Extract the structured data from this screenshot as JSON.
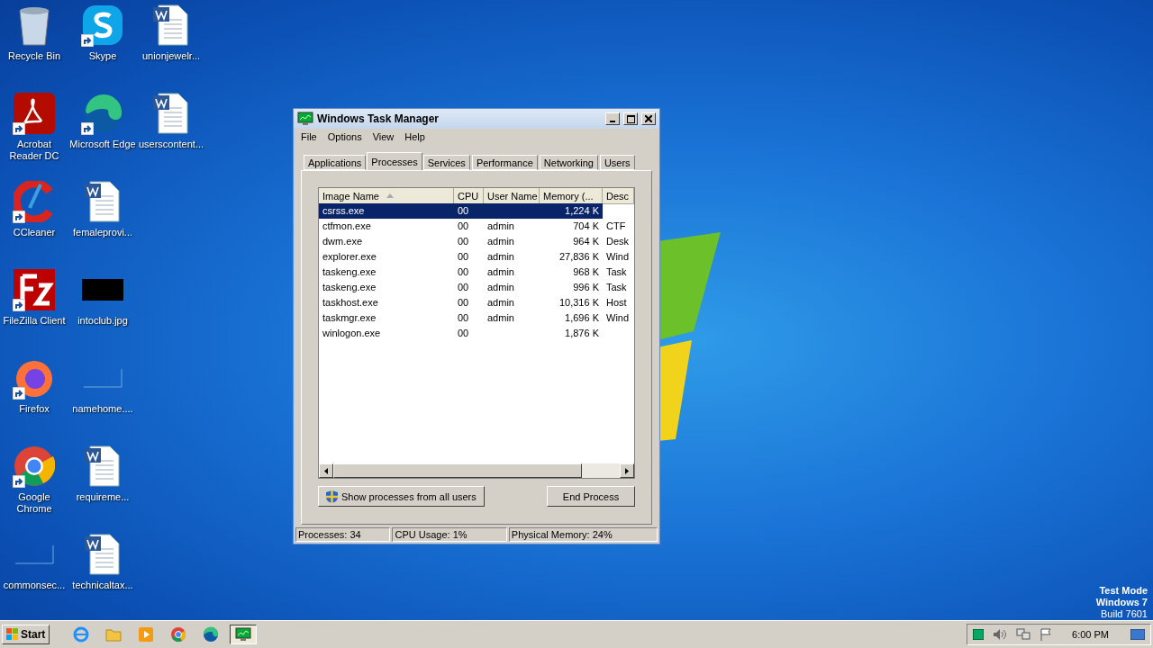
{
  "desktop_icons": [
    {
      "label": "Recycle Bin",
      "kind": "recycle",
      "shortcut": false
    },
    {
      "label": "Acrobat Reader DC",
      "kind": "acrobat",
      "shortcut": true
    },
    {
      "label": "CCleaner",
      "kind": "ccleaner",
      "shortcut": true
    },
    {
      "label": "FileZilla Client",
      "kind": "filezilla",
      "shortcut": true
    },
    {
      "label": "Firefox",
      "kind": "firefox",
      "shortcut": true
    },
    {
      "label": "Google Chrome",
      "kind": "chrome",
      "shortcut": true
    },
    {
      "label": "commonsec...",
      "kind": "blank",
      "shortcut": false
    },
    {
      "label": "Skype",
      "kind": "skype",
      "shortcut": true
    },
    {
      "label": "Microsoft Edge",
      "kind": "edge",
      "shortcut": true
    },
    {
      "label": "femaleprovi...",
      "kind": "word",
      "shortcut": false
    },
    {
      "label": "intoclub.jpg",
      "kind": "image",
      "shortcut": false
    },
    {
      "label": "namehome....",
      "kind": "blank",
      "shortcut": false
    },
    {
      "label": "requireme...",
      "kind": "word",
      "shortcut": false
    },
    {
      "label": "technicaltax...",
      "kind": "word",
      "shortcut": false
    },
    {
      "label": "unionjewelr...",
      "kind": "word",
      "shortcut": false
    },
    {
      "label": "userscontent...",
      "kind": "word",
      "shortcut": false
    }
  ],
  "window": {
    "title": "Windows Task Manager",
    "menu": [
      "File",
      "Options",
      "View",
      "Help"
    ],
    "tabs": [
      {
        "label": "Applications",
        "selected": false
      },
      {
        "label": "Processes",
        "selected": true
      },
      {
        "label": "Services",
        "selected": false
      },
      {
        "label": "Performance",
        "selected": false
      },
      {
        "label": "Networking",
        "selected": false
      },
      {
        "label": "Users",
        "selected": false
      }
    ],
    "table": {
      "columns": [
        "Image Name",
        "CPU",
        "User Name",
        "Memory (...",
        "Desc"
      ],
      "rows": [
        {
          "cells": [
            "csrss.exe",
            "00",
            "",
            "1,224 K",
            ""
          ],
          "selected": true
        },
        {
          "cells": [
            "ctfmon.exe",
            "00",
            "admin",
            "704 K",
            "CTF"
          ],
          "selected": false
        },
        {
          "cells": [
            "dwm.exe",
            "00",
            "admin",
            "964 K",
            "Desk"
          ],
          "selected": false
        },
        {
          "cells": [
            "explorer.exe",
            "00",
            "admin",
            "27,836 K",
            "Wind"
          ],
          "selected": false
        },
        {
          "cells": [
            "taskeng.exe",
            "00",
            "admin",
            "968 K",
            "Task"
          ],
          "selected": false
        },
        {
          "cells": [
            "taskeng.exe",
            "00",
            "admin",
            "996 K",
            "Task"
          ],
          "selected": false
        },
        {
          "cells": [
            "taskhost.exe",
            "00",
            "admin",
            "10,316 K",
            "Host"
          ],
          "selected": false
        },
        {
          "cells": [
            "taskmgr.exe",
            "00",
            "admin",
            "1,696 K",
            "Wind"
          ],
          "selected": false
        },
        {
          "cells": [
            "winlogon.exe",
            "00",
            "",
            "1,876 K",
            ""
          ],
          "selected": false
        }
      ]
    },
    "show_all_button": "Show processes from all users",
    "end_button": "End Process",
    "status_bar": [
      "Processes: 34",
      "CPU Usage: 1%",
      "Physical Memory: 24%"
    ]
  },
  "os_notice": [
    "Test Mode",
    "Windows 7",
    "Build 7601"
  ],
  "taskbar": {
    "start": "Start",
    "apps": [
      {
        "kind": "ie",
        "selected": false
      },
      {
        "kind": "folder",
        "selected": false
      },
      {
        "kind": "media",
        "selected": false
      },
      {
        "kind": "chrome",
        "selected": false
      },
      {
        "kind": "edge",
        "selected": false
      },
      {
        "kind": "taskmgr",
        "selected": true
      }
    ],
    "clock": "6:00 PM"
  }
}
